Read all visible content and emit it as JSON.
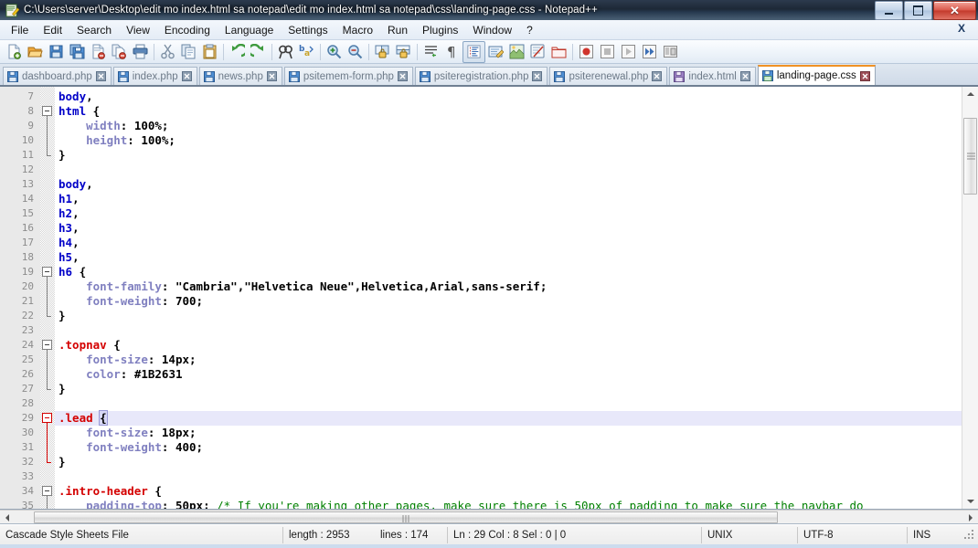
{
  "window": {
    "title": "C:\\Users\\server\\Desktop\\edit mo index.html sa notepad\\edit mo index.html sa notepad\\css\\landing-page.css - Notepad++",
    "app_icon": "notepad-plus-plus-icon",
    "minimize_label": "",
    "maximize_label": "",
    "close_label": "✕"
  },
  "menubar": {
    "items": [
      {
        "label": "File"
      },
      {
        "label": "Edit"
      },
      {
        "label": "Search"
      },
      {
        "label": "View"
      },
      {
        "label": "Encoding"
      },
      {
        "label": "Language"
      },
      {
        "label": "Settings"
      },
      {
        "label": "Macro"
      },
      {
        "label": "Run"
      },
      {
        "label": "Plugins"
      },
      {
        "label": "Window"
      },
      {
        "label": "?"
      }
    ],
    "close_document_label": "X"
  },
  "toolbar": {
    "buttons": [
      {
        "name": "new-file-icon",
        "title": "New"
      },
      {
        "name": "open-file-icon",
        "title": "Open"
      },
      {
        "name": "save-icon",
        "title": "Save"
      },
      {
        "name": "save-all-icon",
        "title": "Save All"
      },
      {
        "name": "close-file-icon",
        "title": "Close"
      },
      {
        "name": "close-all-files-icon",
        "title": "Close All"
      },
      {
        "name": "print-icon",
        "title": "Print"
      },
      {
        "name": "separator-1",
        "title": ""
      },
      {
        "name": "cut-icon",
        "title": "Cut"
      },
      {
        "name": "copy-icon",
        "title": "Copy"
      },
      {
        "name": "paste-icon",
        "title": "Paste"
      },
      {
        "name": "separator-2",
        "title": ""
      },
      {
        "name": "undo-icon",
        "title": "Undo"
      },
      {
        "name": "redo-icon",
        "title": "Redo"
      },
      {
        "name": "separator-3",
        "title": ""
      },
      {
        "name": "find-icon",
        "title": "Find"
      },
      {
        "name": "replace-icon",
        "title": "Replace"
      },
      {
        "name": "separator-4",
        "title": ""
      },
      {
        "name": "zoom-in-icon",
        "title": "Zoom In"
      },
      {
        "name": "zoom-out-icon",
        "title": "Zoom Out"
      },
      {
        "name": "separator-5",
        "title": ""
      },
      {
        "name": "sync-vertical-scroll-icon",
        "title": "Synchronize Vertical Scrolling"
      },
      {
        "name": "sync-horizontal-scroll-icon",
        "title": "Synchronize Horizontal Scrolling"
      },
      {
        "name": "separator-6",
        "title": ""
      },
      {
        "name": "word-wrap-icon",
        "title": "Word Wrap"
      },
      {
        "name": "show-all-characters-icon",
        "title": "Show All Characters"
      },
      {
        "name": "indent-guide-icon",
        "title": "Show Indent Guide"
      },
      {
        "name": "user-defined-language-icon",
        "title": "User Defined Dialogue"
      },
      {
        "name": "document-map-icon",
        "title": "Document Map"
      },
      {
        "name": "function-list-icon",
        "title": "Function List"
      },
      {
        "name": "folder-as-workspace-icon",
        "title": "Folder as Workspace"
      },
      {
        "name": "separator-7",
        "title": ""
      },
      {
        "name": "macro-record-icon",
        "title": "Start Recording"
      },
      {
        "name": "macro-stop-icon",
        "title": "Stop Recording"
      },
      {
        "name": "macro-play-icon",
        "title": "Playback"
      },
      {
        "name": "macro-run-multiple-icon",
        "title": "Run a Macro Multiple Times"
      },
      {
        "name": "macro-save-icon",
        "title": "Save Current Recorded Macro"
      }
    ]
  },
  "tabs": [
    {
      "label": "dashboard.php",
      "active": false,
      "icon": "save-file-blue-icon"
    },
    {
      "label": "index.php",
      "active": false,
      "icon": "save-file-blue-icon"
    },
    {
      "label": "news.php",
      "active": false,
      "icon": "save-file-blue-icon"
    },
    {
      "label": "psitemem-form.php",
      "active": false,
      "icon": "save-file-blue-icon"
    },
    {
      "label": "psiteregistration.php",
      "active": false,
      "icon": "save-file-blue-icon"
    },
    {
      "label": "psiterenewal.php",
      "active": false,
      "icon": "save-file-blue-icon"
    },
    {
      "label": "index.html",
      "active": false,
      "icon": "save-file-purple-icon"
    },
    {
      "label": "landing-page.css",
      "active": true,
      "icon": "save-file-green-icon"
    }
  ],
  "editor": {
    "first_line": 7,
    "current_line": 29,
    "lines": [
      {
        "n": 7,
        "tokens": [
          {
            "t": "tag",
            "v": "body"
          },
          {
            "t": "punc",
            "v": ","
          }
        ]
      },
      {
        "n": 8,
        "tokens": [
          {
            "t": "tag",
            "v": "html"
          },
          {
            "t": "plain",
            "v": " "
          },
          {
            "t": "punc",
            "v": "{"
          }
        ],
        "fold": "start"
      },
      {
        "n": 9,
        "tokens": [
          {
            "t": "plain",
            "v": "    "
          },
          {
            "t": "prop",
            "v": "width"
          },
          {
            "t": "punc",
            "v": ":"
          },
          {
            "t": "plain",
            "v": " "
          },
          {
            "t": "val",
            "v": "100%;"
          }
        ]
      },
      {
        "n": 10,
        "tokens": [
          {
            "t": "plain",
            "v": "    "
          },
          {
            "t": "prop",
            "v": "height"
          },
          {
            "t": "punc",
            "v": ":"
          },
          {
            "t": "plain",
            "v": " "
          },
          {
            "t": "val",
            "v": "100%;"
          }
        ]
      },
      {
        "n": 11,
        "tokens": [
          {
            "t": "punc",
            "v": "}"
          }
        ],
        "fold": "end"
      },
      {
        "n": 12,
        "tokens": []
      },
      {
        "n": 13,
        "tokens": [
          {
            "t": "tag",
            "v": "body"
          },
          {
            "t": "punc",
            "v": ","
          }
        ]
      },
      {
        "n": 14,
        "tokens": [
          {
            "t": "tag",
            "v": "h1"
          },
          {
            "t": "punc",
            "v": ","
          }
        ]
      },
      {
        "n": 15,
        "tokens": [
          {
            "t": "tag",
            "v": "h2"
          },
          {
            "t": "punc",
            "v": ","
          }
        ]
      },
      {
        "n": 16,
        "tokens": [
          {
            "t": "tag",
            "v": "h3"
          },
          {
            "t": "punc",
            "v": ","
          }
        ]
      },
      {
        "n": 17,
        "tokens": [
          {
            "t": "tag",
            "v": "h4"
          },
          {
            "t": "punc",
            "v": ","
          }
        ]
      },
      {
        "n": 18,
        "tokens": [
          {
            "t": "tag",
            "v": "h5"
          },
          {
            "t": "punc",
            "v": ","
          }
        ]
      },
      {
        "n": 19,
        "tokens": [
          {
            "t": "tag",
            "v": "h6"
          },
          {
            "t": "plain",
            "v": " "
          },
          {
            "t": "punc",
            "v": "{"
          }
        ],
        "fold": "start"
      },
      {
        "n": 20,
        "tokens": [
          {
            "t": "plain",
            "v": "    "
          },
          {
            "t": "prop",
            "v": "font-family"
          },
          {
            "t": "punc",
            "v": ":"
          },
          {
            "t": "plain",
            "v": " "
          },
          {
            "t": "val",
            "v": "\"Cambria\",\"Helvetica Neue\",Helvetica,Arial,sans-serif;"
          }
        ]
      },
      {
        "n": 21,
        "tokens": [
          {
            "t": "plain",
            "v": "    "
          },
          {
            "t": "prop",
            "v": "font-weight"
          },
          {
            "t": "punc",
            "v": ":"
          },
          {
            "t": "plain",
            "v": " "
          },
          {
            "t": "val",
            "v": "700;"
          }
        ]
      },
      {
        "n": 22,
        "tokens": [
          {
            "t": "punc",
            "v": "}"
          }
        ],
        "fold": "end"
      },
      {
        "n": 23,
        "tokens": []
      },
      {
        "n": 24,
        "tokens": [
          {
            "t": "class",
            "v": ".topnav"
          },
          {
            "t": "plain",
            "v": " "
          },
          {
            "t": "punc",
            "v": "{"
          }
        ],
        "fold": "start"
      },
      {
        "n": 25,
        "tokens": [
          {
            "t": "plain",
            "v": "    "
          },
          {
            "t": "prop",
            "v": "font-size"
          },
          {
            "t": "punc",
            "v": ":"
          },
          {
            "t": "plain",
            "v": " "
          },
          {
            "t": "val",
            "v": "14px;"
          }
        ]
      },
      {
        "n": 26,
        "tokens": [
          {
            "t": "plain",
            "v": "    "
          },
          {
            "t": "prop",
            "v": "color"
          },
          {
            "t": "punc",
            "v": ":"
          },
          {
            "t": "plain",
            "v": " "
          },
          {
            "t": "val",
            "v": "#1B2631"
          }
        ]
      },
      {
        "n": 27,
        "tokens": [
          {
            "t": "punc",
            "v": "}"
          }
        ],
        "fold": "end"
      },
      {
        "n": 28,
        "tokens": []
      },
      {
        "n": 29,
        "tokens": [
          {
            "t": "class",
            "v": ".lead"
          },
          {
            "t": "plain",
            "v": " "
          },
          {
            "t": "brace",
            "v": "{"
          }
        ],
        "fold": "start-red",
        "current": true
      },
      {
        "n": 30,
        "tokens": [
          {
            "t": "plain",
            "v": "    "
          },
          {
            "t": "prop",
            "v": "font-size"
          },
          {
            "t": "punc",
            "v": ":"
          },
          {
            "t": "plain",
            "v": " "
          },
          {
            "t": "val",
            "v": "18px;"
          }
        ]
      },
      {
        "n": 31,
        "tokens": [
          {
            "t": "plain",
            "v": "    "
          },
          {
            "t": "prop",
            "v": "font-weight"
          },
          {
            "t": "punc",
            "v": ":"
          },
          {
            "t": "plain",
            "v": " "
          },
          {
            "t": "val",
            "v": "400;"
          }
        ]
      },
      {
        "n": 32,
        "tokens": [
          {
            "t": "punc",
            "v": "}"
          }
        ],
        "fold": "end-red"
      },
      {
        "n": 33,
        "tokens": []
      },
      {
        "n": 34,
        "tokens": [
          {
            "t": "class",
            "v": ".intro-header"
          },
          {
            "t": "plain",
            "v": " "
          },
          {
            "t": "punc",
            "v": "{"
          }
        ],
        "fold": "start"
      },
      {
        "n": 35,
        "tokens": [
          {
            "t": "plain",
            "v": "    "
          },
          {
            "t": "prop",
            "v": "padding-top"
          },
          {
            "t": "punc",
            "v": ":"
          },
          {
            "t": "plain",
            "v": " "
          },
          {
            "t": "val",
            "v": "50px;"
          },
          {
            "t": "plain",
            "v": " "
          },
          {
            "t": "comment",
            "v": "/* If you're making other pages, make sure there is 50px of padding to make sure the navbar do"
          }
        ]
      }
    ]
  },
  "scrollbars": {
    "vertical": {
      "up_arrow": "▲",
      "down_arrow": "▼",
      "thumb_top_pct": 4,
      "thumb_height_pct": 18
    },
    "horizontal": {
      "left_arrow": "◀",
      "right_arrow": "▶",
      "thumb_left_pct": 2,
      "thumb_width_pct": 76
    }
  },
  "statusbar": {
    "file_type": "Cascade Style Sheets File",
    "length_label": "length : 2953",
    "lines_label": "lines : 174",
    "position_label": "Ln : 29   Col : 8   Sel : 0 | 0",
    "eol_format": "UNIX",
    "encoding": "UTF-8",
    "insert_mode": "INS"
  }
}
